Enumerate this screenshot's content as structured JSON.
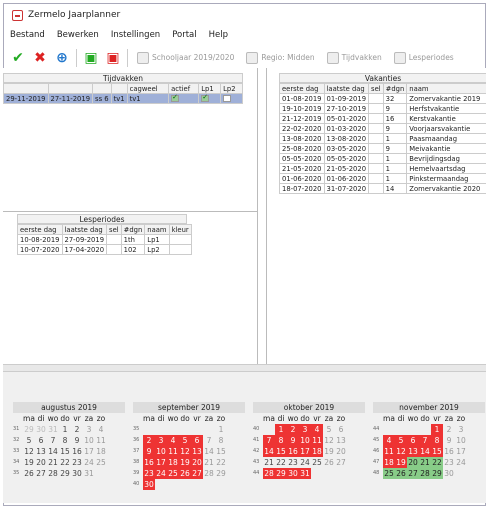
{
  "window": {
    "title": "Zermelo Jaarplanner"
  },
  "menu": [
    "Bestand",
    "Bewerken",
    "Instellingen",
    "Portal",
    "Help"
  ],
  "toolbar": {
    "schooljaar": "Schooljaar 2019/2020",
    "regio": "Regio: Midden",
    "tijdvakken": "Tijdvakken",
    "lesperiodes": "Lesperiodes"
  },
  "tijdvakken": {
    "title": "Tijdvakken",
    "headers": [
      "",
      "",
      "",
      "",
      "cagweel",
      "actief",
      "Lp1",
      "Lp2"
    ],
    "rows": [
      [
        "29-11-2019",
        "27-11-2019",
        "ss 6",
        "tv1",
        "tv1"
      ]
    ]
  },
  "lesperiodes": {
    "title": "Lesperiodes",
    "headers": [
      "eerste dag",
      "laatste dag",
      "sel",
      "#dgn",
      "naam",
      "kleur"
    ],
    "rows": [
      [
        "10-08-2019",
        "27-09-2019",
        "",
        "1th",
        "Lp1",
        ""
      ],
      [
        "10-07-2020",
        "17-04-2020",
        "",
        "102",
        "Lp2",
        ""
      ]
    ]
  },
  "vakanties": {
    "title": "Vakanties",
    "headers": [
      "eerste dag",
      "laatste dag",
      "sel",
      "#dgn",
      "naam",
      "kl"
    ],
    "rows": [
      [
        "01-08-2019",
        "01-09-2019",
        "",
        "32",
        "Zomervakantie 2019"
      ],
      [
        "19-10-2019",
        "27-10-2019",
        "",
        "9",
        "Herfstvakantie"
      ],
      [
        "21-12-2019",
        "05-01-2020",
        "",
        "16",
        "Kerstvakantie"
      ],
      [
        "22-02-2020",
        "01-03-2020",
        "",
        "9",
        "Voorjaarsvakantie"
      ],
      [
        "13-08-2020",
        "13-08-2020",
        "",
        "1",
        "Paasmaandag"
      ],
      [
        "25-08-2020",
        "03-05-2020",
        "",
        "9",
        "Meivakantie"
      ],
      [
        "05-05-2020",
        "05-05-2020",
        "",
        "1",
        "Bevrijdingsdag"
      ],
      [
        "21-05-2020",
        "21-05-2020",
        "",
        "1",
        "Hemelvaartsdag"
      ],
      [
        "01-06-2020",
        "01-06-2020",
        "",
        "1",
        "Pinkstermaandag"
      ],
      [
        "18-07-2020",
        "31-07-2020",
        "",
        "14",
        "Zomervakantie 2020"
      ]
    ]
  },
  "calendar": {
    "dow": [
      "ma",
      "di",
      "wo",
      "do",
      "vr",
      "za",
      "zo"
    ],
    "months": [
      {
        "name": "augustus 2019",
        "weeks": [
          {
            "wn": "31",
            "days": [
              "29",
              "30",
              "31",
              "1",
              "2",
              "3",
              "4"
            ],
            "st": [
              "o",
              "o",
              "o",
              "",
              "",
              "w",
              "w"
            ]
          },
          {
            "wn": "32",
            "days": [
              "5",
              "6",
              "7",
              "8",
              "9",
              "10",
              "11"
            ],
            "st": [
              "",
              "",
              "",
              "",
              "",
              "w",
              "w"
            ]
          },
          {
            "wn": "33",
            "days": [
              "12",
              "13",
              "14",
              "15",
              "16",
              "17",
              "18"
            ],
            "st": [
              "",
              "",
              "",
              "",
              "",
              "w",
              "w"
            ]
          },
          {
            "wn": "34",
            "days": [
              "19",
              "20",
              "21",
              "22",
              "23",
              "24",
              "25"
            ],
            "st": [
              "",
              "",
              "",
              "",
              "",
              "w",
              "w"
            ]
          },
          {
            "wn": "35",
            "days": [
              "26",
              "27",
              "28",
              "29",
              "30",
              "31",
              ""
            ],
            "st": [
              "",
              "",
              "",
              "",
              "",
              "w",
              "w"
            ]
          }
        ]
      },
      {
        "name": "september 2019",
        "weeks": [
          {
            "wn": "35",
            "days": [
              "",
              "",
              "",
              "",
              "",
              "",
              "1"
            ],
            "st": [
              "",
              "",
              "",
              "",
              "",
              "",
              "w"
            ]
          },
          {
            "wn": "36",
            "days": [
              "2",
              "3",
              "4",
              "5",
              "6",
              "7",
              "8"
            ],
            "st": [
              "h",
              "h",
              "h",
              "h",
              "h",
              "w",
              "w"
            ]
          },
          {
            "wn": "37",
            "days": [
              "9",
              "10",
              "11",
              "12",
              "13",
              "14",
              "15"
            ],
            "st": [
              "h",
              "h",
              "h",
              "h",
              "h",
              "w",
              "w"
            ]
          },
          {
            "wn": "38",
            "days": [
              "16",
              "17",
              "18",
              "19",
              "20",
              "21",
              "22"
            ],
            "st": [
              "h",
              "h",
              "h",
              "h",
              "h",
              "w",
              "w"
            ]
          },
          {
            "wn": "39",
            "days": [
              "23",
              "24",
              "25",
              "26",
              "27",
              "28",
              "29"
            ],
            "st": [
              "h",
              "h",
              "h",
              "h",
              "h",
              "w",
              "w"
            ]
          },
          {
            "wn": "40",
            "days": [
              "30",
              "",
              "",
              "",
              "",
              "",
              ""
            ],
            "st": [
              "h",
              "",
              "",
              "",
              "",
              "",
              ""
            ]
          }
        ]
      },
      {
        "name": "oktober 2019",
        "weeks": [
          {
            "wn": "40",
            "days": [
              "",
              "1",
              "2",
              "3",
              "4",
              "5",
              "6"
            ],
            "st": [
              "",
              "h",
              "h",
              "h",
              "h",
              "w",
              "w"
            ]
          },
          {
            "wn": "41",
            "days": [
              "7",
              "8",
              "9",
              "10",
              "11",
              "12",
              "13"
            ],
            "st": [
              "h",
              "h",
              "h",
              "h",
              "h",
              "w",
              "w"
            ]
          },
          {
            "wn": "42",
            "days": [
              "14",
              "15",
              "16",
              "17",
              "18",
              "19",
              "20"
            ],
            "st": [
              "h",
              "h",
              "h",
              "h",
              "h",
              "w",
              "w"
            ]
          },
          {
            "wn": "43",
            "days": [
              "21",
              "22",
              "23",
              "24",
              "25",
              "26",
              "27"
            ],
            "st": [
              "",
              "",
              "",
              "",
              "",
              "w",
              "w"
            ]
          },
          {
            "wn": "44",
            "days": [
              "28",
              "29",
              "30",
              "31",
              "",
              "",
              ""
            ],
            "st": [
              "h",
              "h",
              "h",
              "h",
              "",
              "",
              ""
            ]
          }
        ]
      },
      {
        "name": "november 2019",
        "weeks": [
          {
            "wn": "44",
            "days": [
              "",
              "",
              "",
              "",
              "1",
              "2",
              "3"
            ],
            "st": [
              "",
              "",
              "",
              "",
              "h",
              "w",
              "w"
            ]
          },
          {
            "wn": "45",
            "days": [
              "4",
              "5",
              "6",
              "7",
              "8",
              "9",
              "10"
            ],
            "st": [
              "h",
              "h",
              "h",
              "h",
              "h",
              "w",
              "w"
            ]
          },
          {
            "wn": "46",
            "days": [
              "11",
              "12",
              "13",
              "14",
              "15",
              "16",
              "17"
            ],
            "st": [
              "h",
              "h",
              "h",
              "h",
              "h",
              "w",
              "w"
            ]
          },
          {
            "wn": "47",
            "days": [
              "18",
              "19",
              "20",
              "21",
              "22",
              "23",
              "24"
            ],
            "st": [
              "h",
              "h",
              "g",
              "g",
              "g",
              "w",
              "w"
            ]
          },
          {
            "wn": "48",
            "days": [
              "25",
              "26",
              "27",
              "28",
              "29",
              "30",
              ""
            ],
            "st": [
              "g",
              "g",
              "g",
              "g",
              "g",
              "w",
              "w"
            ]
          }
        ]
      }
    ]
  }
}
